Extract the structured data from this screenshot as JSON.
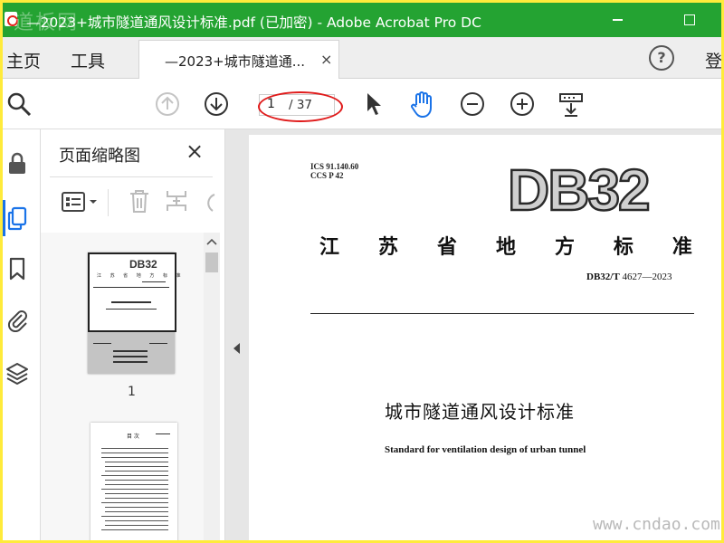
{
  "titlebar": {
    "watermark": "道板网",
    "title": "—2023+城市隧道通风设计标准.pdf  (已加密)  - Adobe Acrobat Pro DC"
  },
  "tabbar": {
    "home": "主页",
    "tools": "工具",
    "doc_tab": "—2023+城市隧道通...",
    "doc_tab_close": "×",
    "help": "?",
    "login": "登"
  },
  "toolbar": {
    "page_current": "1",
    "page_total": "/ 37"
  },
  "thumbnails": {
    "title": "页面缩略图",
    "close": "×",
    "page1_label": "1",
    "thumb1_logo": "DB32",
    "thumb1_header": "江 苏 省 地 方 标 准",
    "thumb2_title": "目   次"
  },
  "document": {
    "ics": "ICS  91.140.60",
    "ccs": "CCS  P 42",
    "logo": "DB32",
    "province_standard": [
      "江",
      "苏",
      "省",
      "地",
      "方",
      "标",
      "准"
    ],
    "code_prefix": "DB32/T",
    "code_rest": " 4627—2023",
    "title_cn": "城市隧道通风设计标准",
    "title_en": "Standard for ventilation design of urban tunnel"
  },
  "watermark": "www.cndao.com",
  "colors": {
    "titlebar": "#24a332",
    "frame": "#ffeb3b",
    "highlight": "#e01b1b",
    "active": "#1a73e8"
  }
}
